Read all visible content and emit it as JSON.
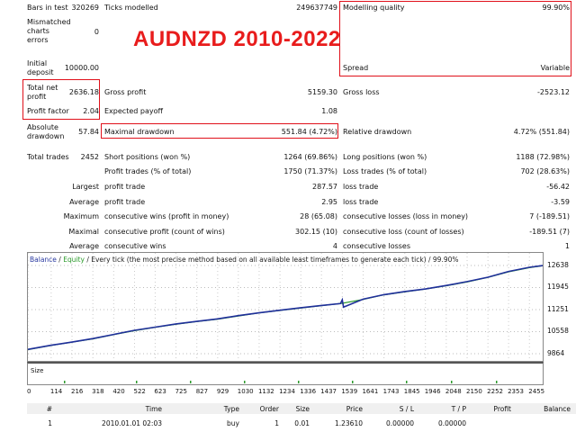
{
  "title": "AUDNZD 2010-2022",
  "colors": {
    "highlight_box": "#e0101a",
    "title": "#e81c1c",
    "balance_line": "#1f2f9a",
    "equity_line": "#2b9a2b"
  },
  "stats": {
    "bars_in_test_label": "Bars in test",
    "bars_in_test_value": "320269",
    "ticks_modelled_label": "Ticks modelled",
    "ticks_modelled_value": "249637749",
    "modelling_quality_label": "Modelling quality",
    "modelling_quality_value": "99.90%",
    "mismatched_label_1": "Mismatched",
    "mismatched_label_2": "charts",
    "mismatched_label_3": "errors",
    "mismatched_value": "0",
    "initial_deposit_label_1": "Initial",
    "initial_deposit_label_2": "deposit",
    "initial_deposit_value": "10000.00",
    "spread_label": "Spread",
    "spread_value": "Variable",
    "total_net_profit_label_1": "Total net",
    "total_net_profit_label_2": "profit",
    "total_net_profit_value": "2636.18",
    "gross_profit_label": "Gross profit",
    "gross_profit_value": "5159.30",
    "gross_loss_label": "Gross loss",
    "gross_loss_value": "-2523.12",
    "profit_factor_label": "Profit factor",
    "profit_factor_value": "2.04",
    "expected_payoff_label": "Expected payoff",
    "expected_payoff_value": "1.08",
    "absolute_drawdown_label_1": "Absolute",
    "absolute_drawdown_label_2": "drawdown",
    "absolute_drawdown_value": "57.84",
    "maximal_drawdown_label": "Maximal drawdown",
    "maximal_drawdown_value": "551.84 (4.72%)",
    "relative_drawdown_label": "Relative drawdown",
    "relative_drawdown_value": "4.72% (551.84)",
    "total_trades_label": "Total trades",
    "total_trades_value": "2452",
    "short_positions_label": "Short positions (won %)",
    "short_positions_value": "1264 (69.86%)",
    "long_positions_label": "Long positions (won %)",
    "long_positions_value": "1188 (72.98%)",
    "profit_trades_label": "Profit trades (% of total)",
    "profit_trades_value": "1750 (71.37%)",
    "loss_trades_label": "Loss trades (% of total)",
    "loss_trades_value": "702 (28.63%)",
    "largest_label": "Largest",
    "largest_profit_label": "profit trade",
    "largest_profit_value": "287.57",
    "largest_loss_label": "loss trade",
    "largest_loss_value": "-56.42",
    "average_label": "Average",
    "average_profit_label": "profit trade",
    "average_profit_value": "2.95",
    "average_loss_label": "loss trade",
    "average_loss_value": "-3.59",
    "maximum_label": "Maximum",
    "max_cons_wins_label": "consecutive wins (profit in money)",
    "max_cons_wins_value": "28 (65.08)",
    "max_cons_losses_label": "consecutive losses (loss in money)",
    "max_cons_losses_value": "7 (-189.51)",
    "maximal_label": "Maximal",
    "maximal_cons_profit_label": "consecutive profit (count of wins)",
    "maximal_cons_profit_value": "302.15 (10)",
    "maximal_cons_loss_label": "consecutive loss (count of losses)",
    "maximal_cons_loss_value": "-189.51 (7)",
    "average2_label": "Average",
    "avg_cons_wins_label": "consecutive wins",
    "avg_cons_wins_value": "4",
    "avg_cons_losses_label": "consecutive losses",
    "avg_cons_losses_value": "1"
  },
  "chart": {
    "legend_balance": "Balance",
    "legend_sep": " / ",
    "legend_equity": "Equity",
    "legend_rest": " / Every tick (the most precise method based on all available least timeframes to generate each tick) / 99.90%",
    "size_label": "Size",
    "y_ticks": [
      "12638",
      "11945",
      "11251",
      "10558",
      "9864"
    ],
    "x_ticks": [
      "0",
      "114",
      "216",
      "318",
      "420",
      "522",
      "623",
      "725",
      "827",
      "929",
      "1030",
      "1132",
      "1234",
      "1336",
      "1437",
      "1539",
      "1641",
      "1743",
      "1845",
      "1946",
      "2048",
      "2150",
      "2252",
      "2353",
      "2455"
    ]
  },
  "chart_data": {
    "type": "line",
    "title": "",
    "xlabel": "",
    "ylabel": "",
    "ylim": [
      9864,
      12638
    ],
    "xlim": [
      0,
      2520
    ],
    "series": [
      {
        "name": "Balance",
        "x": [
          0,
          114,
          216,
          318,
          420,
          522,
          623,
          725,
          827,
          929,
          1030,
          1132,
          1234,
          1336,
          1437,
          1530,
          1539,
          1545,
          1641,
          1743,
          1845,
          1946,
          2048,
          2150,
          2252,
          2353,
          2455,
          2520
        ],
        "values": [
          10000,
          10130,
          10230,
          10340,
          10470,
          10600,
          10700,
          10800,
          10880,
          10960,
          11060,
          11150,
          11230,
          11310,
          11380,
          11440,
          11560,
          11330,
          11580,
          11720,
          11820,
          11900,
          12010,
          12130,
          12270,
          12450,
          12580,
          12636
        ]
      },
      {
        "name": "Equity",
        "x": [
          0,
          114,
          216,
          318,
          420,
          522,
          623,
          725,
          827,
          929,
          1030,
          1132,
          1234,
          1336,
          1437,
          1539,
          1641,
          1743,
          1845,
          1946,
          2048,
          2150,
          2252,
          2353,
          2455,
          2520
        ],
        "values": [
          9990,
          10125,
          10225,
          10330,
          10465,
          10590,
          10695,
          10790,
          10875,
          10950,
          11050,
          11145,
          11225,
          11300,
          11375,
          11450,
          11570,
          11715,
          11810,
          11895,
          12000,
          12120,
          12265,
          12440,
          12570,
          12630
        ]
      }
    ]
  },
  "table": {
    "headers": [
      "#",
      "Time",
      "Type",
      "Order",
      "Size",
      "Price",
      "S / L",
      "T / P",
      "Profit",
      "Balance"
    ],
    "rows": [
      [
        "1",
        "2010.01.01 02:03",
        "buy",
        "1",
        "0.01",
        "1.23610",
        "0.00000",
        "0.00000",
        "",
        ""
      ]
    ]
  }
}
